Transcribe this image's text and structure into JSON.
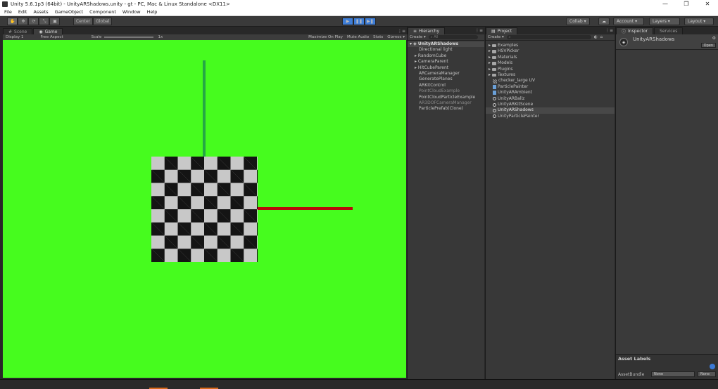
{
  "window": {
    "title": "Unity 5.6.1p3 (64bit) - UnityARShadows.unity - gt - PC, Mac & Linux Standalone <DX11>",
    "minimize": "—",
    "maximize": "❐",
    "close": "✕"
  },
  "menu": [
    "File",
    "Edit",
    "Assets",
    "GameObject",
    "Component",
    "Window",
    "Help"
  ],
  "toolbar": {
    "pivot_center": "Center",
    "pivot_global": "Global",
    "collab": "Collab ▾",
    "account": "Account ▾",
    "layers": "Layers ▾",
    "layout": "Layout ▾",
    "play_color": "#3e7dd6"
  },
  "game_panel": {
    "tab_scene": "Scene",
    "tab_game": "Game",
    "display": "Display 1",
    "aspect": "Free Aspect",
    "scale_label": "Scale",
    "scale_value": "1x",
    "maximize": "Maximize On Play",
    "mute": "Mute Audio",
    "stats": "Stats",
    "gizmos": "Gizmos ▾",
    "background_color": "#46fc1e"
  },
  "hierarchy": {
    "tab": "Hierarchy",
    "create": "Create ▾",
    "search_placeholder": "All",
    "root": "UnityARShadows",
    "items": [
      {
        "label": "Directional light",
        "expandable": false,
        "dim": false
      },
      {
        "label": "RandomCube",
        "expandable": true,
        "dim": false
      },
      {
        "label": "CameraParent",
        "expandable": true,
        "dim": false
      },
      {
        "label": "HitCubeParent",
        "expandable": true,
        "dim": false
      },
      {
        "label": "ARCameraManager",
        "expandable": false,
        "dim": false
      },
      {
        "label": "GeneratePlanes",
        "expandable": false,
        "dim": false
      },
      {
        "label": "ARKitControl",
        "expandable": false,
        "dim": false
      },
      {
        "label": "PointCloudExample",
        "expandable": false,
        "dim": true
      },
      {
        "label": "PointCloudParticleExample",
        "expandable": false,
        "dim": false
      },
      {
        "label": "AR3DOFCameraManager",
        "expandable": false,
        "dim": true
      },
      {
        "label": "ParticlePrefab(Clone)",
        "expandable": false,
        "dim": false
      }
    ]
  },
  "project": {
    "tab": "Project",
    "create": "Create ▾",
    "items": [
      {
        "label": "Examples",
        "type": "folder",
        "selected": false
      },
      {
        "label": "HSVPicker",
        "type": "folder",
        "selected": false
      },
      {
        "label": "Materials",
        "type": "folder",
        "selected": false
      },
      {
        "label": "Models",
        "type": "folder",
        "selected": false
      },
      {
        "label": "Plugins",
        "type": "folder",
        "selected": false
      },
      {
        "label": "Textures",
        "type": "folder",
        "selected": false
      },
      {
        "label": "checker_large UV",
        "type": "texture",
        "selected": false
      },
      {
        "label": "ParticlePainter",
        "type": "script",
        "selected": false
      },
      {
        "label": "UnityARAmbient",
        "type": "script",
        "selected": false
      },
      {
        "label": "UnityARBallz",
        "type": "scene",
        "selected": false
      },
      {
        "label": "UnityARKitScene",
        "type": "scene",
        "selected": false
      },
      {
        "label": "UnityARShadows",
        "type": "scene",
        "selected": true
      },
      {
        "label": "UnityParticlePainter",
        "type": "scene",
        "selected": false
      }
    ]
  },
  "inspector": {
    "tab": "Inspector",
    "tab_services": "Services",
    "object_name": "UnityARShadows",
    "open_button": "Open",
    "asset_labels": "Asset Labels",
    "asset_bundle_label": "AssetBundle",
    "asset_bundle_value": "None",
    "asset_bundle_variant": "None"
  }
}
